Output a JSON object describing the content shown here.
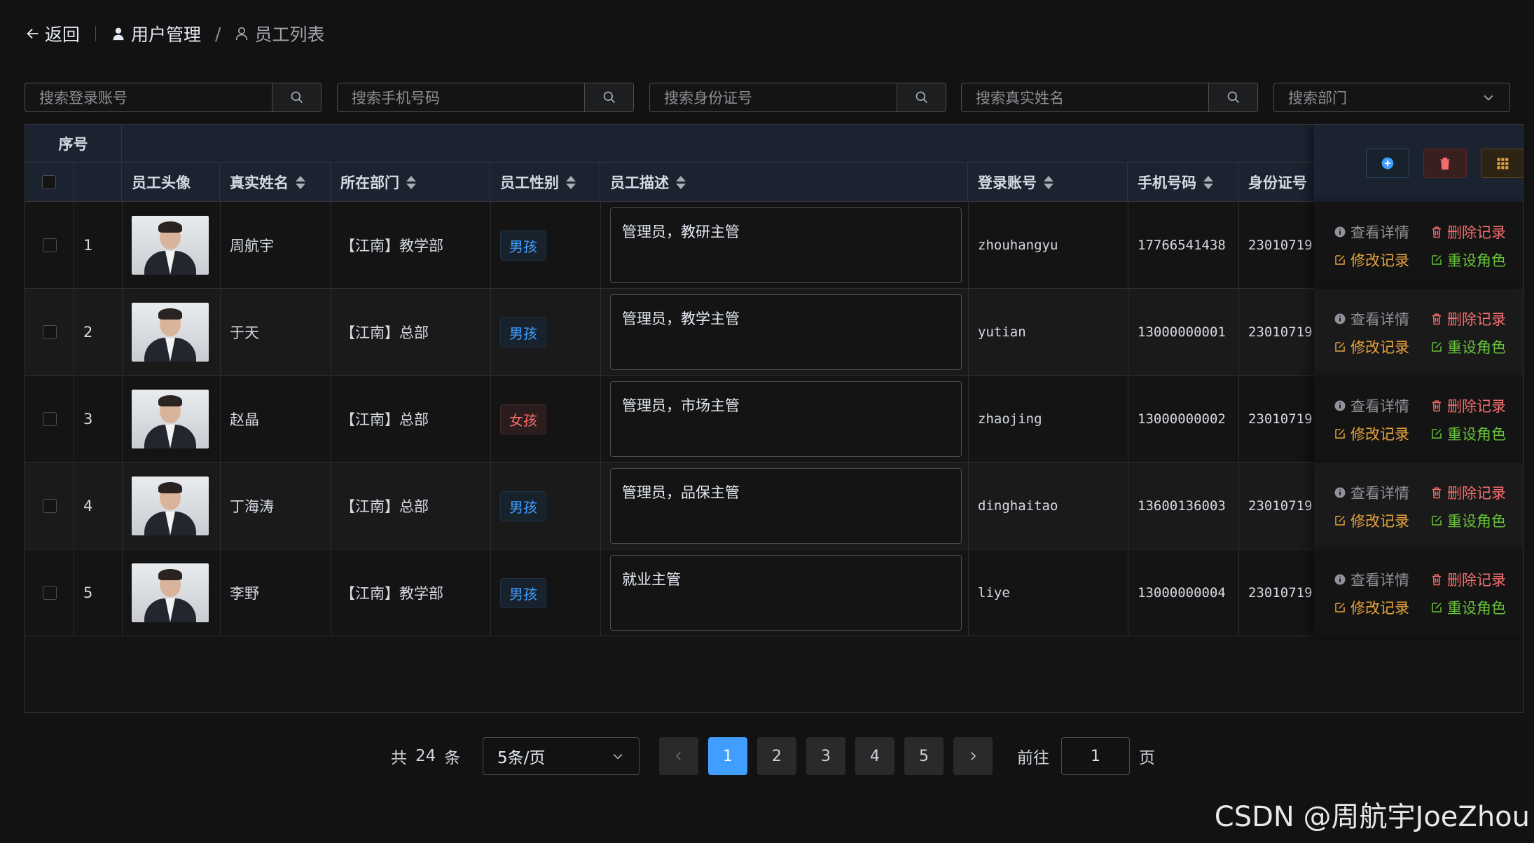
{
  "header": {
    "back_label": "返回",
    "crumb1": "用户管理",
    "crumb_sep": "/",
    "crumb2": "员工列表"
  },
  "search": {
    "account_placeholder": "搜索登录账号",
    "phone_placeholder": "搜索手机号码",
    "idcard_placeholder": "搜索身份证号",
    "name_placeholder": "搜索真实姓名",
    "dept_placeholder": "搜索部门"
  },
  "table": {
    "group_header": "序号",
    "columns": {
      "avatar": "员工头像",
      "name": "真实姓名",
      "dept": "所在部门",
      "gender": "员工性别",
      "desc": "员工描述",
      "account": "登录账号",
      "phone": "手机号码",
      "idcard": "身份证号"
    },
    "rows": [
      {
        "no": "1",
        "name": "周航宇",
        "dept": "【江南】教学部",
        "gender": "男孩",
        "gender_type": "m",
        "desc": "管理员，教研主管",
        "account": "zhouhangyu",
        "phone": "17766541438",
        "idcard": "23010719"
      },
      {
        "no": "2",
        "name": "于天",
        "dept": "【江南】总部",
        "gender": "男孩",
        "gender_type": "m",
        "desc": "管理员，教学主管",
        "account": "yutian",
        "phone": "13000000001",
        "idcard": "23010719"
      },
      {
        "no": "3",
        "name": "赵晶",
        "dept": "【江南】总部",
        "gender": "女孩",
        "gender_type": "f",
        "desc": "管理员，市场主管",
        "account": "zhaojing",
        "phone": "13000000002",
        "idcard": "23010719"
      },
      {
        "no": "4",
        "name": "丁海涛",
        "dept": "【江南】总部",
        "gender": "男孩",
        "gender_type": "m",
        "desc": "管理员，品保主管",
        "account": "dinghaitao",
        "phone": "13600136003",
        "idcard": "23010719"
      },
      {
        "no": "5",
        "name": "李野",
        "dept": "【江南】教学部",
        "gender": "男孩",
        "gender_type": "m",
        "desc": "就业主管",
        "account": "liye",
        "phone": "13000000004",
        "idcard": "23010719"
      }
    ],
    "actions": {
      "view": "查看详情",
      "delete": "删除记录",
      "edit": "修改记录",
      "reset": "重设角色"
    }
  },
  "toolbar_icons": [
    "plus-circle-icon",
    "trash-icon",
    "grid-icon"
  ],
  "colors": {
    "primary": "#409eff",
    "danger": "#f56c6c",
    "warning": "#e6a23c",
    "success": "#67c23a",
    "info": "#909399"
  },
  "pagination": {
    "total_prefix": "共",
    "total": "24",
    "total_suffix": "条",
    "page_size": "5条/页",
    "pages": [
      "1",
      "2",
      "3",
      "4",
      "5"
    ],
    "current": "1",
    "goto_prefix": "前往",
    "goto_value": "1",
    "goto_suffix": "页"
  },
  "watermark": "CSDN @周航宇JoeZhou"
}
